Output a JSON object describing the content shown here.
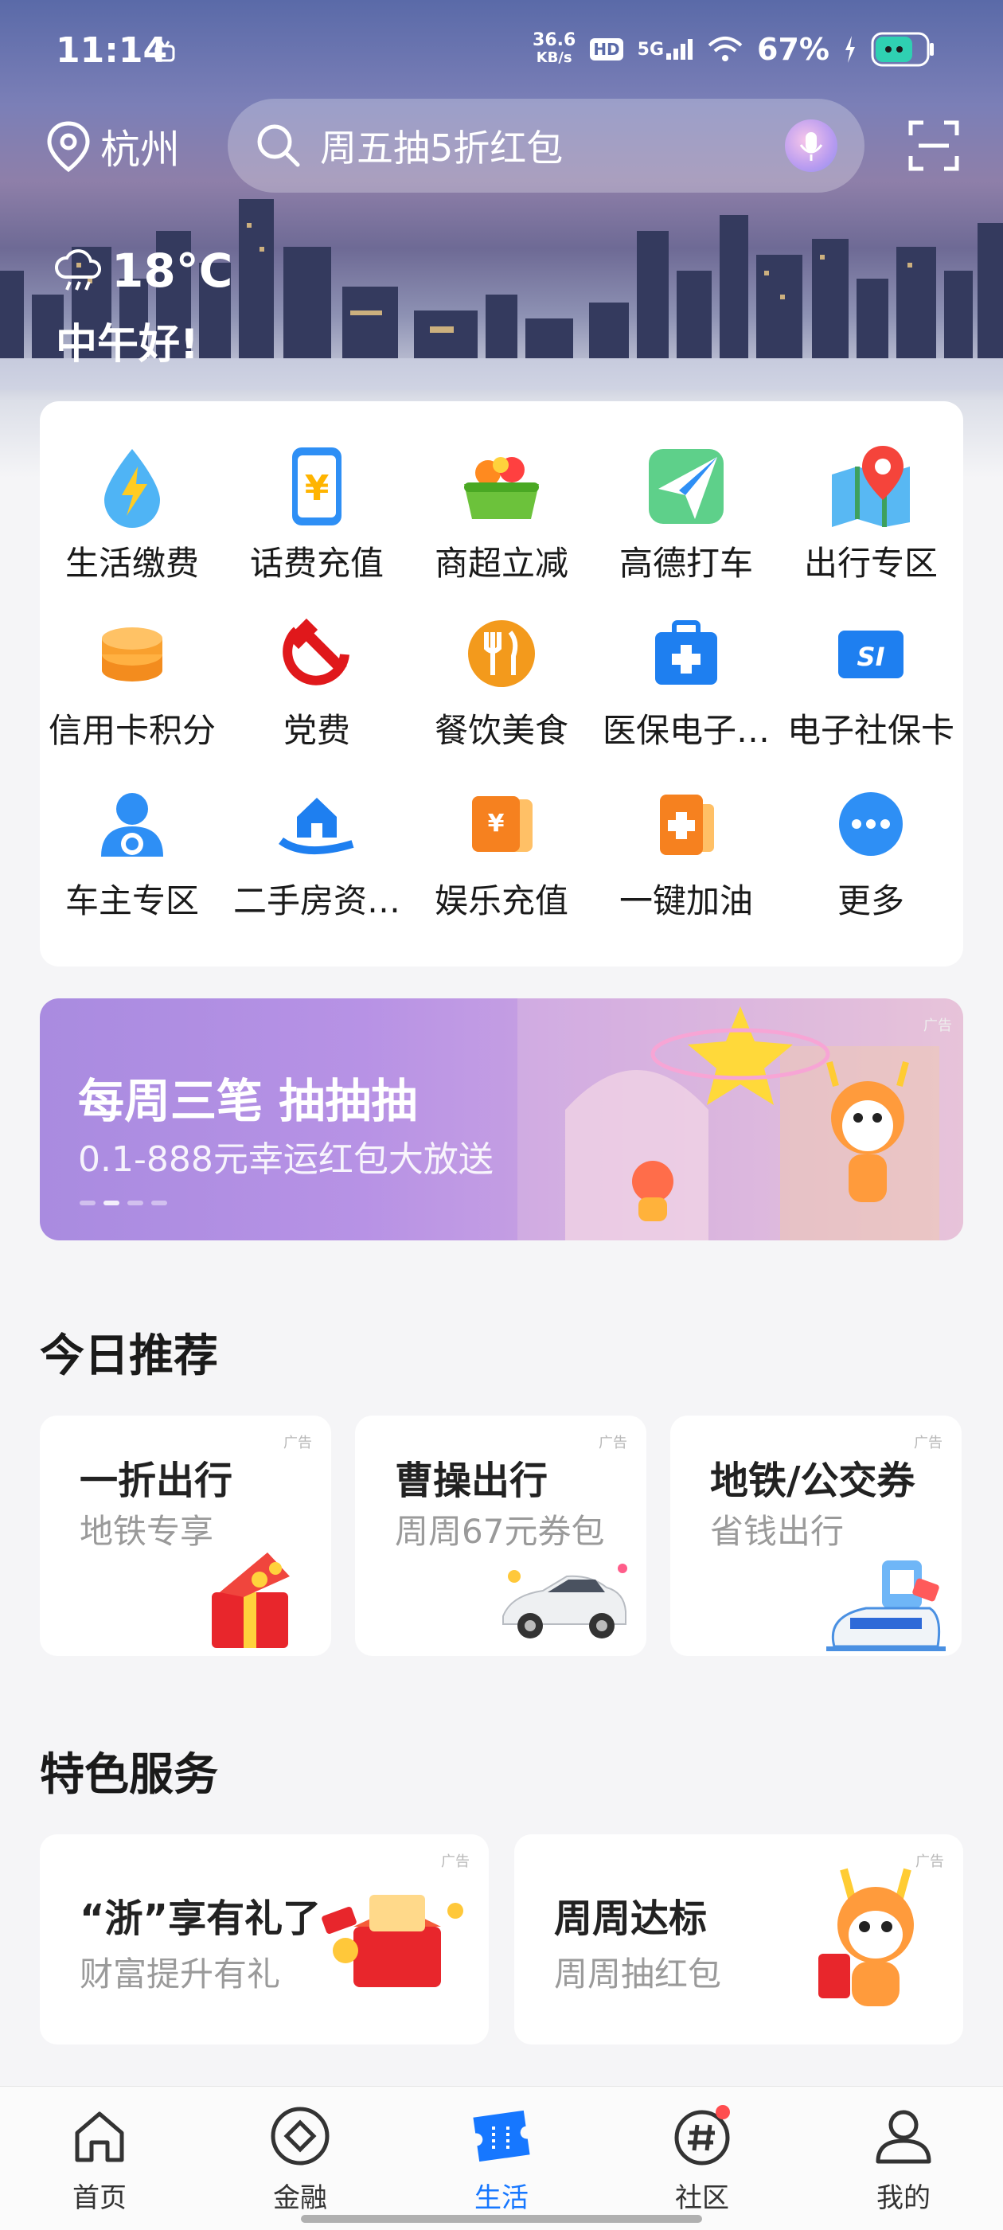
{
  "status_bar": {
    "time": "11:14",
    "net_speed_top": "36.6",
    "net_speed_unit": "KB/s",
    "hd": "HD",
    "net_type": "5G",
    "battery": "67%"
  },
  "location": {
    "city": "杭州"
  },
  "search": {
    "placeholder": "周五抽5折红包"
  },
  "weather": {
    "temp": "18°C",
    "greeting": "中午好!"
  },
  "services": [
    {
      "label": "生活缴费",
      "icon": "lightning-drop-icon"
    },
    {
      "label": "话费充值",
      "icon": "phone-yuan-icon"
    },
    {
      "label": "商超立减",
      "icon": "basket-icon"
    },
    {
      "label": "高德打车",
      "icon": "paper-plane-icon"
    },
    {
      "label": "出行专区",
      "icon": "map-pin-icon"
    },
    {
      "label": "信用卡积分",
      "icon": "coins-stack-icon"
    },
    {
      "label": "党费",
      "icon": "hammer-sickle-icon"
    },
    {
      "label": "餐饮美食",
      "icon": "fork-knife-icon"
    },
    {
      "label": "医保电子…",
      "icon": "medical-kit-icon"
    },
    {
      "label": "电子社保卡",
      "icon": "si-card-icon"
    },
    {
      "label": "车主专区",
      "icon": "car-owner-icon"
    },
    {
      "label": "二手房资…",
      "icon": "house-hand-icon"
    },
    {
      "label": "娱乐充值",
      "icon": "yuan-ticket-icon"
    },
    {
      "label": "一键加油",
      "icon": "fuel-plus-icon"
    },
    {
      "label": "更多",
      "icon": "more-dots-icon"
    }
  ],
  "banner": {
    "title": "每周三笔 抽抽抽",
    "subtitle": "0.1-888元幸运红包大放送",
    "ad": "广告"
  },
  "today": {
    "title": "今日推荐",
    "cards": [
      {
        "title": "一折出行",
        "subtitle": "地铁专享",
        "ad": "广告"
      },
      {
        "title": "曹操出行",
        "subtitle": "周周67元券包",
        "ad": "广告"
      },
      {
        "title": "地铁/公交券",
        "subtitle": "省钱出行",
        "ad": "广告"
      }
    ]
  },
  "featured": {
    "title": "特色服务",
    "cards": [
      {
        "title": "“浙”享有礼了",
        "subtitle": "财富提升有礼",
        "ad": "广告"
      },
      {
        "title": "周周达标",
        "subtitle": "周周抽红包",
        "ad": "广告"
      }
    ]
  },
  "tabs": [
    {
      "label": "首页",
      "icon": "home-icon"
    },
    {
      "label": "金融",
      "icon": "diamond-icon"
    },
    {
      "label": "生活",
      "icon": "ticket-icon",
      "active": true
    },
    {
      "label": "社区",
      "icon": "hashtag-icon"
    },
    {
      "label": "我的",
      "icon": "person-icon"
    }
  ],
  "colors": {
    "accent": "#1677ff",
    "badge": "#ff4d4f"
  }
}
